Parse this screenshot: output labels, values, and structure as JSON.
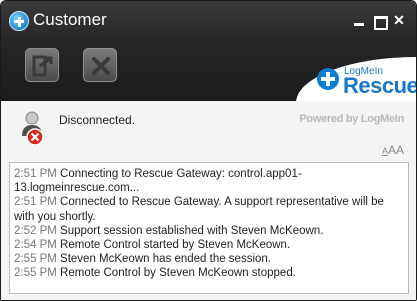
{
  "window": {
    "title": "Customer",
    "close_glyph": "✕"
  },
  "toolbar": {
    "buttons": [
      {
        "icon": "exit-session-icon"
      },
      {
        "icon": "close-x-icon"
      }
    ]
  },
  "brand": {
    "logo_top": "LogMeIn",
    "logo_main": "Rescue",
    "powered_by": "Powered by LogMeIn"
  },
  "status": {
    "text": "Disconnected.",
    "icon": "disconnected-user-icon"
  },
  "text_size_control": {
    "small": "A",
    "large": "AA"
  },
  "log": [
    {
      "time": "2:51 PM",
      "message": "Connecting to Rescue Gateway: control.app01-13.logmeinrescue.com..."
    },
    {
      "time": "2:51 PM",
      "message": "Connected to Rescue Gateway. A support representative will be with you shortly."
    },
    {
      "time": "2:52 PM",
      "message": "Support session established with Steven McKeown."
    },
    {
      "time": "2:54 PM",
      "message": "Remote Control started by Steven McKeown."
    },
    {
      "time": "2:55 PM",
      "message": "Steven McKeown has ended the session."
    },
    {
      "time": "2:55 PM",
      "message": "Remote Control by Steven McKeown stopped."
    }
  ]
}
